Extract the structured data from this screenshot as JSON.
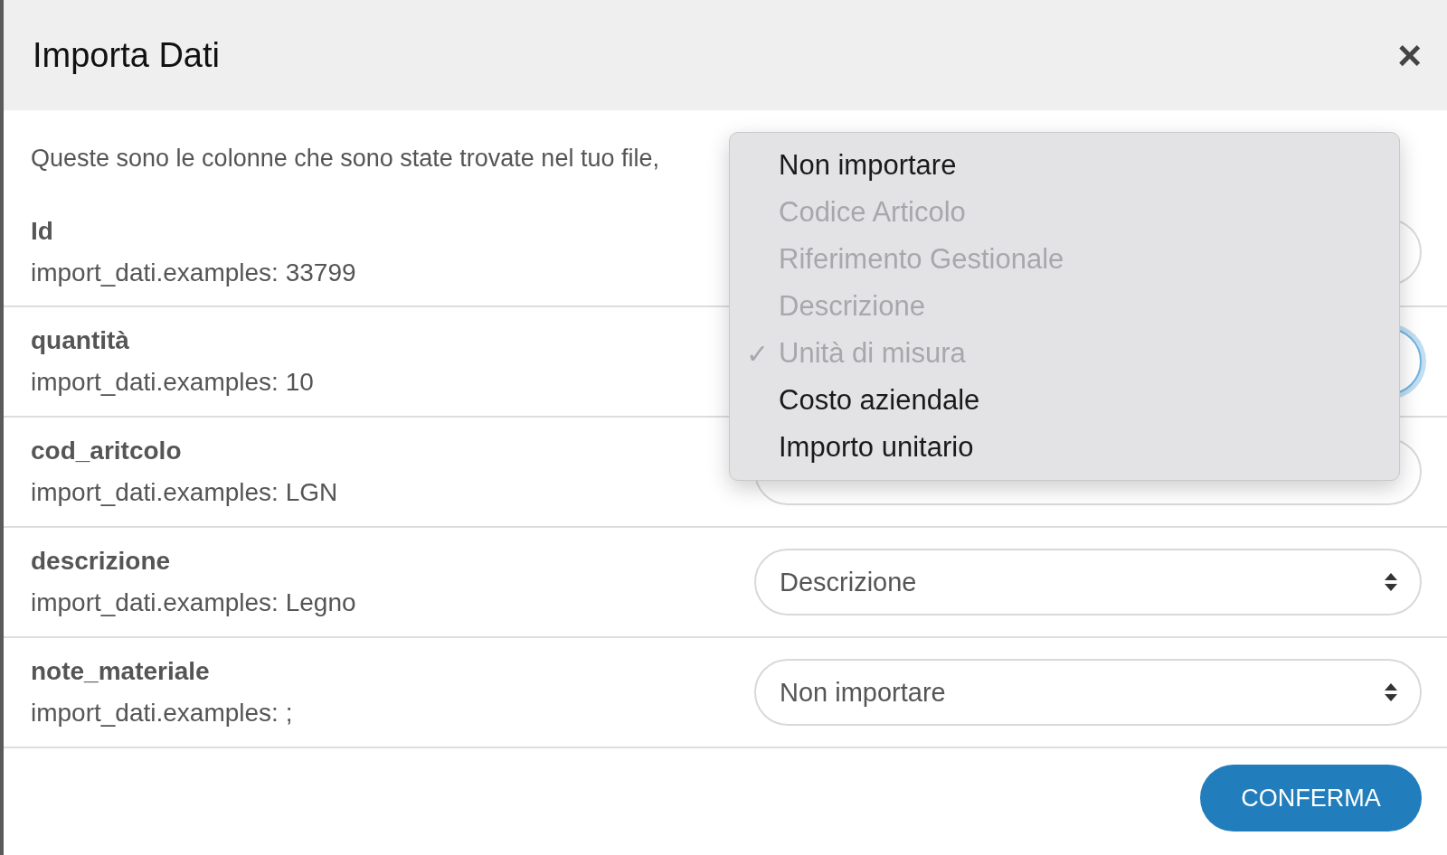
{
  "dialog": {
    "title": "Importa Dati",
    "close": "×"
  },
  "intro": "Queste sono le colonne che sono state trovate nel tuo file,",
  "rows": [
    {
      "name": "Id",
      "example": "import_dati.examples: 33799",
      "focused": false
    },
    {
      "name": "quantità",
      "example": "import_dati.examples: 10",
      "focused": true
    },
    {
      "name": "cod_aritcolo",
      "example": "import_dati.examples: LGN",
      "focused": false
    },
    {
      "name": "descrizione",
      "example": "import_dati.examples: Legno",
      "value": "Descrizione",
      "focused": false
    },
    {
      "name": "note_materiale",
      "example": "import_dati.examples: ;",
      "value": "Non importare",
      "focused": false
    }
  ],
  "dropdown": {
    "check": "✓",
    "options": [
      {
        "label": "Non importare",
        "disabled": false,
        "selected": false
      },
      {
        "label": "Codice Articolo",
        "disabled": true,
        "selected": false
      },
      {
        "label": "Riferimento Gestionale",
        "disabled": true,
        "selected": false
      },
      {
        "label": "Descrizione",
        "disabled": true,
        "selected": false
      },
      {
        "label": "Unità di misura",
        "disabled": true,
        "selected": true
      },
      {
        "label": "Costo aziendale",
        "disabled": false,
        "selected": false
      },
      {
        "label": "Importo unitario",
        "disabled": false,
        "selected": false
      }
    ]
  },
  "confirm": "CONFERMA"
}
